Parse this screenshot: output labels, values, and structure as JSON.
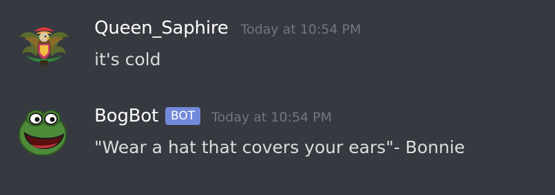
{
  "messages": [
    {
      "username": "Queen_Saphire",
      "timestamp": "Today at 10:54 PM",
      "content": "it's cold",
      "avatar_icon": "eagle-crest-avatar-icon"
    },
    {
      "username": "BogBot",
      "bot_tag": "BOT",
      "timestamp": "Today at 10:54 PM",
      "content": "\"Wear a hat that covers your ears\"- Bonnie",
      "avatar_icon": "frog-face-avatar-icon"
    }
  ],
  "colors": {
    "background": "#36393f",
    "username": "#ffffff",
    "timestamp": "#72767d",
    "message_text": "#dcddde",
    "bot_tag": "#7289da"
  }
}
